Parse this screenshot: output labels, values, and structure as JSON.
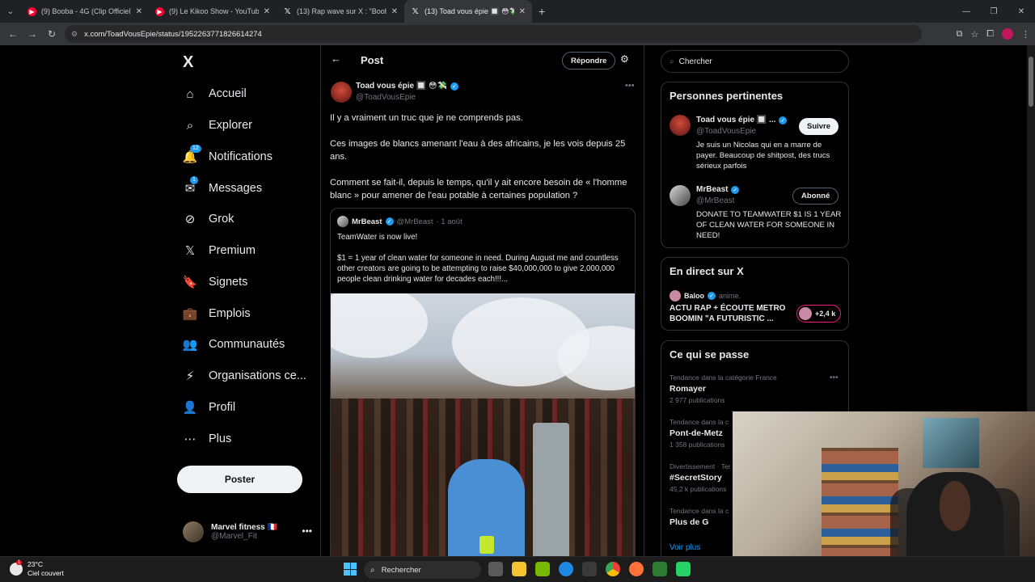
{
  "browser": {
    "tabs": [
      {
        "title": "(9) Booba - 4G (Clip Officiel) - YouTube",
        "icon": "youtube-icon",
        "active": false
      },
      {
        "title": "(9) Le Kikoo Show - YouTube",
        "icon": "youtube-icon",
        "active": false
      },
      {
        "title": "(13) Rap wave sur X : \"Booba a",
        "icon": "x-icon",
        "active": false
      },
      {
        "title": "(13) Toad vous épie 🔲 😳💸 sur X",
        "icon": "x-icon",
        "active": true
      }
    ],
    "url": "x.com/ToadVousEpie/status/1952263771826614274"
  },
  "nav": {
    "logo": "X",
    "items": [
      {
        "label": "Accueil",
        "icon": "home-icon",
        "glyph": "⌂"
      },
      {
        "label": "Explorer",
        "icon": "search-icon",
        "glyph": "⌕"
      },
      {
        "label": "Notifications",
        "icon": "bell-icon",
        "glyph": "🔔",
        "badge": "12"
      },
      {
        "label": "Messages",
        "icon": "envelope-icon",
        "glyph": "✉",
        "badge": "1"
      },
      {
        "label": "Grok",
        "icon": "grok-icon",
        "glyph": "⊘"
      },
      {
        "label": "Premium",
        "icon": "x-premium-icon",
        "glyph": "𝕏"
      },
      {
        "label": "Signets",
        "icon": "bookmark-icon",
        "glyph": "🔖"
      },
      {
        "label": "Emplois",
        "icon": "briefcase-icon",
        "glyph": "💼"
      },
      {
        "label": "Communautés",
        "icon": "communities-icon",
        "glyph": "👥"
      },
      {
        "label": "Organisations ce...",
        "icon": "lightning-icon",
        "glyph": "⚡"
      },
      {
        "label": "Profil",
        "icon": "person-icon",
        "glyph": "👤"
      },
      {
        "label": "Plus",
        "icon": "more-circle-icon",
        "glyph": "⋯"
      }
    ],
    "post_button": "Poster",
    "account": {
      "name": "Marvel fitness 🇫🇷",
      "handle": "@Marvel_Fit"
    }
  },
  "main": {
    "header_title": "Post",
    "reply_button": "Répondre",
    "author": {
      "name": "Toad vous épie 🔲 😳💸",
      "handle": "@ToadVousEpie"
    },
    "text": [
      "Il y a vraiment un truc que je ne comprends pas.",
      "Ces images de blancs amenant l'eau à des africains, je les vois depuis 25 ans.",
      "Comment se fait-il, depuis le temps, qu'il y ait encore besoin de « l'homme blanc » pour amener de l'eau potable à certaines population ?"
    ],
    "quote": {
      "name": "MrBeast",
      "handle": "@MrBeast",
      "date": "· 1 août",
      "text": [
        "TeamWater is now live!",
        "$1 = 1 year of clean water for someone in need. During August me and countless other creators are going to be attempting to raise $40,000,000 to give 2,000,000 people clean drinking water for decades each!!!..."
      ]
    }
  },
  "right": {
    "search_placeholder": "Chercher",
    "relevant": {
      "title": "Personnes pertinentes",
      "people": [
        {
          "name": "Toad vous épie 🔲 ...",
          "handle": "@ToadVousEpie",
          "bio": "Je suis un Nicolas qui en a marre de payer. Beaucoup de shitpost, des trucs sérieux parfois",
          "button": "Suivre"
        },
        {
          "name": "MrBeast",
          "handle": "@MrBeast",
          "bio": "DONATE TO TEAMWATER $1 IS 1 YEAR OF CLEAN WATER FOR SOMEONE IN NEED!",
          "button": "Abonné"
        }
      ]
    },
    "live": {
      "title": "En direct sur X",
      "host": "Baloo",
      "action": "anime.",
      "space_title": "ACTU RAP + ÉCOUTE METRO BOOMIN \"A FUTURISTIC ...",
      "listeners": "+2,4 k"
    },
    "trends": {
      "title": "Ce qui se passe",
      "items": [
        {
          "category": "Tendance dans la catégorie France",
          "name": "Romayer",
          "count": "2 977 publications"
        },
        {
          "category": "Tendance dans la c",
          "name": "Pont-de-Metz",
          "count": "1 358 publications"
        },
        {
          "category": "Divertissement · Ter",
          "name": "#SecretStory",
          "count": "45,2 k publications"
        },
        {
          "category": "Tendance dans la c",
          "name": "Plus de G",
          "count": ""
        }
      ],
      "see_more": "Voir plus"
    }
  },
  "taskbar": {
    "temperature": "23°C",
    "weather": "Ciel couvert",
    "search": "Rechercher"
  }
}
